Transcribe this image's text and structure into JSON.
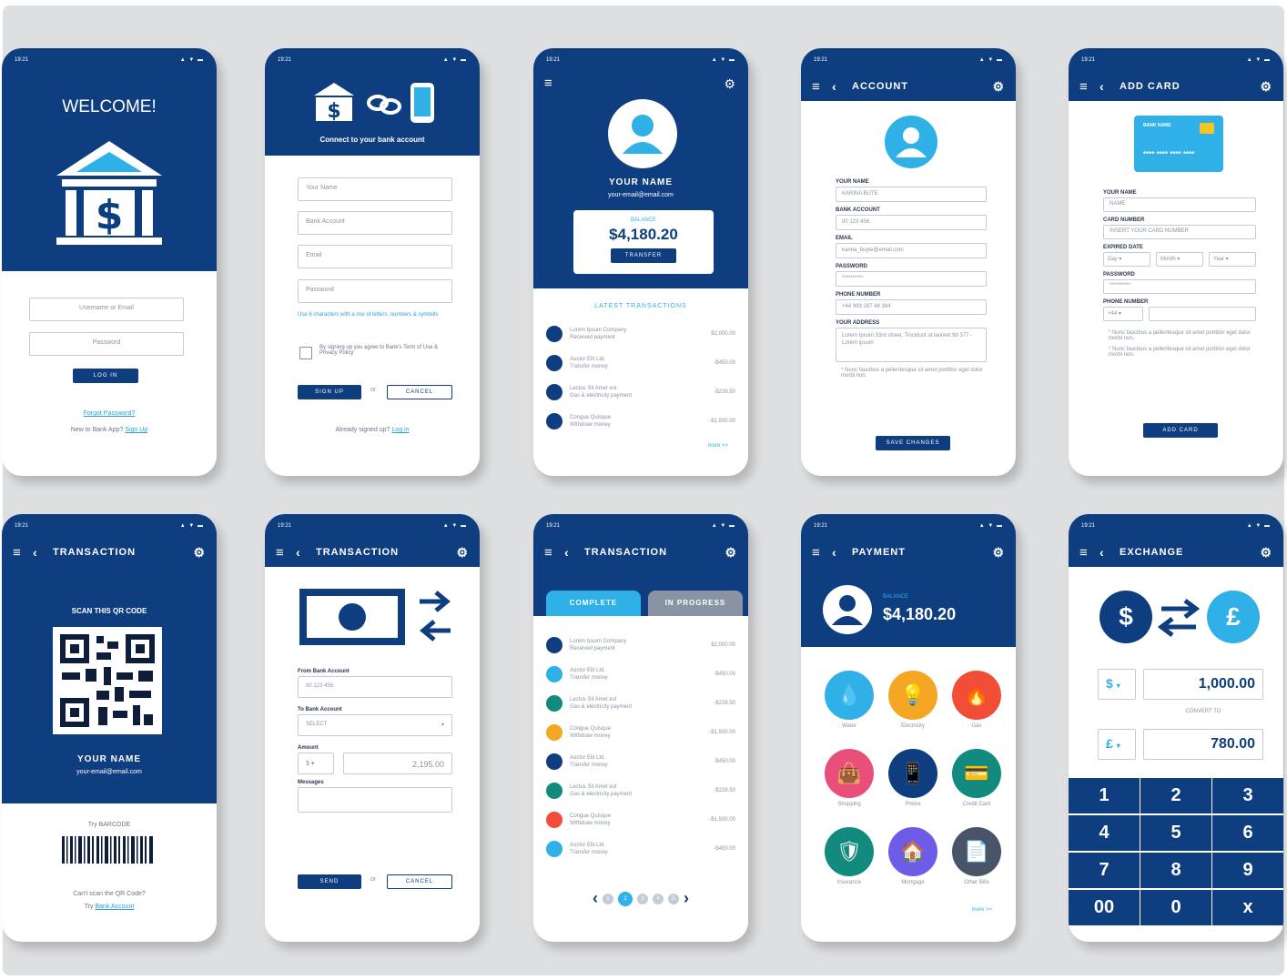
{
  "status_time": "19:21",
  "status_icons": "▲ ▼ ▬",
  "s1": {
    "title": "WELCOME!",
    "user_ph": "Username or Email",
    "pass_ph": "Password",
    "login": "LOG IN",
    "forgot": "Forgot Password?",
    "new_q": "New to Bank App?",
    "signup": "Sign Up"
  },
  "s2": {
    "connect": "Connect to your bank account",
    "f_name": "Your Name",
    "f_bank": "Bank Account",
    "f_email": "Email",
    "f_pass": "Password",
    "hint": "Use 6 characters with a mix of letters, numbers & symbols",
    "terms": "By signing up you agree to Bank's Term of Use & Privacy Policy",
    "signup": "SIGN UP",
    "or": "or",
    "cancel": "CANCEL",
    "already": "Already signed up?",
    "login": "Log in"
  },
  "s3": {
    "name": "YOUR NAME",
    "email": "your-email@email.com",
    "balance_label": "BALANCE",
    "balance": "$4,180.20",
    "transfer": "TRANSFER",
    "latest": "LATEST TRANSACTIONS",
    "more": "more >>",
    "rows": [
      {
        "n1": "Lorem Ipsum Company",
        "n2": "Received payment",
        "a": "$2,000.00"
      },
      {
        "n1": "Auctor Elit Ltd.",
        "n2": "Transfer money",
        "a": "-$450.00"
      },
      {
        "n1": "Lectus Sit Amet est",
        "n2": "Gas & electricity payment",
        "a": "-$239.50"
      },
      {
        "n1": "Congue Quisque",
        "n2": "Withdraw money",
        "a": "-$1,500.00"
      }
    ]
  },
  "s4": {
    "title": "ACCOUNT",
    "l_name": "YOUR NAME",
    "v_name": "KARINA BUTE",
    "l_bank": "BANK ACCOUNT",
    "v_bank": "00 123 456",
    "l_email": "EMAIL",
    "v_email": "karina_buyte@email.com",
    "l_pass": "PASSWORD",
    "v_pass": "**********",
    "l_phone": "PHONE NUMBER",
    "v_phone": "+44 999 287 48 384",
    "l_addr": "YOUR ADDRESS",
    "v_addr": "Lorem Ipsum 33rd street, Tincidunt ut laoreet 99 377 - Lorem ipsum",
    "note": "* Nunc faucibus a pellentesque sit amet porttitor eget dolor morbi non.",
    "save": "SAVE CHANGES"
  },
  "s5": {
    "title": "ADD CARD",
    "card_bank": "BANK NAME",
    "card_num": "**** **** **** ****",
    "l_name": "YOUR NAME",
    "v_name": "NAME",
    "l_card": "CARD NUMBER",
    "v_card": "INSERT YOUR CARD NUMBER",
    "l_exp": "EXPIRED DATE",
    "day": "Day",
    "month": "Month",
    "year": "Year",
    "l_pass": "PASSWORD",
    "v_pass": "**********",
    "l_phone": "PHONE NUMBER",
    "v_code": "+44",
    "note1": "* Nunc faucibus a pellentesque sit amet porttitor eget dolor morbi non.",
    "note2": "* Nunc faucibus a pellentesque sit amet porttitor eget dolor morbi non.",
    "add": "ADD CARD"
  },
  "s6": {
    "title": "TRANSACTION",
    "scan": "SCAN THIS QR CODE",
    "name": "YOUR NAME",
    "email": "your-email@email.com",
    "try_barcode": "Try BARCODE",
    "cant": "Can't scan the QR Code?",
    "try": "Try",
    "bank": "Bank Account"
  },
  "s7": {
    "title": "TRANSACTION",
    "from": "From Bank Account",
    "from_v": "00 123 456",
    "to": "To Bank Account",
    "to_v": "SELECT",
    "amount": "Amount",
    "cur": "$",
    "amount_v": "2,195.00",
    "messages": "Messages",
    "send": "SEND",
    "or": "or",
    "cancel": "CANCEL"
  },
  "s8": {
    "title": "TRANSACTION",
    "tab1": "COMPLETE",
    "tab2": "IN PROGRESS",
    "rows": [
      {
        "n1": "Lorem Ipsum Company",
        "n2": "Received payment",
        "a": "$2,000.00",
        "c": "#0e3e80"
      },
      {
        "n1": "Auctor Elit Ltd.",
        "n2": "Transfer money",
        "a": "-$450.00",
        "c": "#2fb0e6"
      },
      {
        "n1": "Lectus Sit Amet est",
        "n2": "Gas & electricity payment",
        "a": "-$239.50",
        "c": "#128a7e"
      },
      {
        "n1": "Congue Quisque",
        "n2": "Withdraw money",
        "a": "-$1,500.00",
        "c": "#f5a623"
      },
      {
        "n1": "Auctor Elit Ltd.",
        "n2": "Transfer money",
        "a": "-$450.00",
        "c": "#0e3e80"
      },
      {
        "n1": "Lectus Sit Amet est",
        "n2": "Gas & electricity payment",
        "a": "-$239.50",
        "c": "#128a7e"
      },
      {
        "n1": "Congue Quisque",
        "n2": "Withdraw money",
        "a": "-$1,500.00",
        "c": "#f04e37"
      },
      {
        "n1": "Auctor Elit Ltd.",
        "n2": "Transfer money",
        "a": "-$450.00",
        "c": "#2fb0e6"
      }
    ],
    "pages": [
      "1",
      "2",
      "3",
      "4",
      "5"
    ],
    "prev": "‹",
    "next": "›"
  },
  "s9": {
    "title": "PAYMENT",
    "balance_label": "BALANCE",
    "balance": "$4,180.20",
    "more": "more >>",
    "items": [
      {
        "label": "Water",
        "c": "#2fb0e6",
        "i": "💧"
      },
      {
        "label": "Electricity",
        "c": "#f5a623",
        "i": "💡"
      },
      {
        "label": "Gas",
        "c": "#f04e37",
        "i": "🔥"
      },
      {
        "label": "Shopping",
        "c": "#e8507a",
        "i": "👜"
      },
      {
        "label": "Phone",
        "c": "#0e3e80",
        "i": "📱"
      },
      {
        "label": "Credit Card",
        "c": "#128a7e",
        "i": "💳"
      },
      {
        "label": "Insurance",
        "c": "#128a7e",
        "i": "🛡"
      },
      {
        "label": "Mortgage",
        "c": "#6c5ce7",
        "i": "🏠"
      },
      {
        "label": "Other Bills",
        "c": "#4a5468",
        "i": "📄"
      }
    ]
  },
  "s10": {
    "title": "EXCHANGE",
    "from_sym": "$",
    "to_sym": "£",
    "from_cur": "$",
    "from_v": "1,000.00",
    "convert": "CONVERT TO",
    "to_cur": "£",
    "to_v": "780.00",
    "keys": [
      "1",
      "2",
      "3",
      "4",
      "5",
      "6",
      "7",
      "8",
      "9",
      "00",
      "0",
      "x"
    ]
  }
}
